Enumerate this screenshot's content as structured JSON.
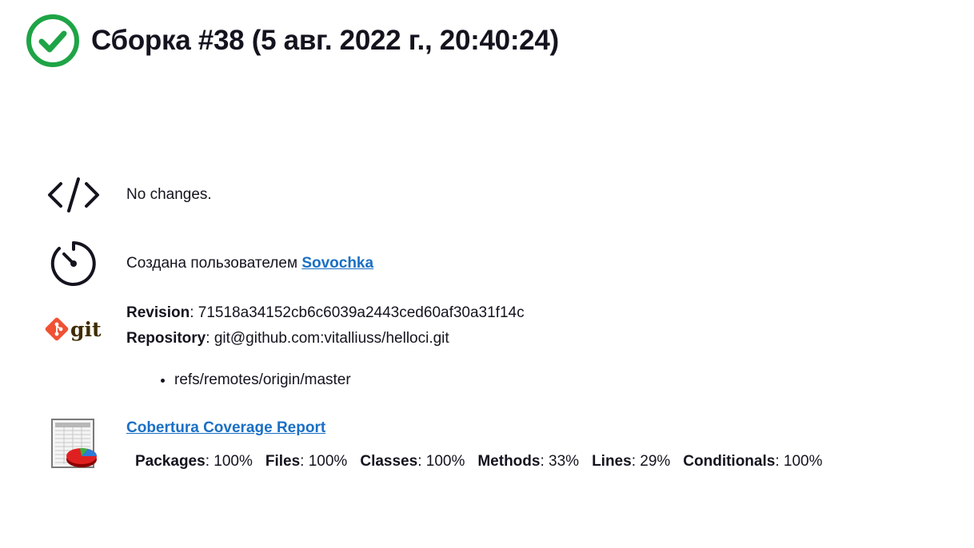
{
  "build": {
    "title": "Сборка #38 (5 авг. 2022 г., 20:40:24)",
    "status_icon": "success-check-icon",
    "status_color": "#1ea446"
  },
  "changes": {
    "icon": "code-icon",
    "text": "No changes."
  },
  "cause": {
    "icon": "timer-icon",
    "prefix": "Создана пользователем",
    "user_link": "Sovochka"
  },
  "git": {
    "icon": "git-logo-icon",
    "revision_label": "Revision",
    "revision_value": "71518a34152cb6c6039a2443ced60af30a31f14c",
    "repository_label": "Repository",
    "repository_value": "git@github.com:vitalliuss/helloci.git",
    "refs": [
      "refs/remotes/origin/master"
    ]
  },
  "coverage": {
    "icon": "coverage-report-icon",
    "link": "Cobertura Coverage Report",
    "metrics": [
      {
        "label": "Packages",
        "value": "100%"
      },
      {
        "label": "Files",
        "value": "100%"
      },
      {
        "label": "Classes",
        "value": "100%"
      },
      {
        "label": "Methods",
        "value": "33%"
      },
      {
        "label": "Lines",
        "value": "29%"
      },
      {
        "label": "Conditionals",
        "value": "100%"
      }
    ]
  },
  "colors": {
    "link": "#1a6fc4",
    "success": "#1ea446",
    "git_orange": "#f05133"
  }
}
